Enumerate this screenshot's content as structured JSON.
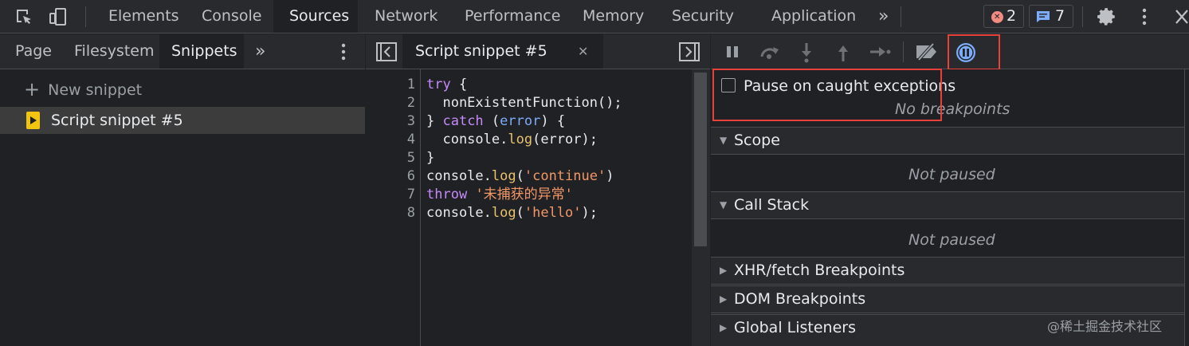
{
  "top_tabs": [
    "Elements",
    "Console",
    "Sources",
    "Network",
    "Performance",
    "Memory",
    "Security",
    "Application"
  ],
  "active_top_tab": "Sources",
  "more_tabs_glyph": "»",
  "badges": {
    "errors": "2",
    "messages": "7"
  },
  "navigator": {
    "tabs": [
      "Page",
      "Filesystem",
      "Snippets"
    ],
    "active_tab": "Snippets",
    "new_snippet": "New snippet",
    "snippets": [
      "Script snippet #5"
    ]
  },
  "editor": {
    "tab_label": "Script snippet #5",
    "line_numbers": [
      "1",
      "2",
      "3",
      "4",
      "5",
      "6",
      "7",
      "8"
    ],
    "lines": [
      [
        {
          "t": "try",
          "c": "kw"
        },
        {
          "t": " {",
          "c": "pr"
        }
      ],
      [
        {
          "t": "  nonExistentFunction();",
          "c": "fn"
        }
      ],
      [
        {
          "t": "} ",
          "c": "pr"
        },
        {
          "t": "catch",
          "c": "kw"
        },
        {
          "t": " (",
          "c": "pr"
        },
        {
          "t": "error",
          "c": "param"
        },
        {
          "t": ") {",
          "c": "pr"
        }
      ],
      [
        {
          "t": "  console.",
          "c": "pr"
        },
        {
          "t": "log",
          "c": "mth"
        },
        {
          "t": "(error);",
          "c": "pr"
        }
      ],
      [
        {
          "t": "}",
          "c": "pr"
        }
      ],
      [
        {
          "t": "console.",
          "c": "pr"
        },
        {
          "t": "log",
          "c": "mth"
        },
        {
          "t": "(",
          "c": "pr"
        },
        {
          "t": "'continue'",
          "c": "str"
        },
        {
          "t": ")",
          "c": "pr"
        }
      ],
      [
        {
          "t": "throw",
          "c": "kw"
        },
        {
          "t": " ",
          "c": "pr"
        },
        {
          "t": "'未捕获的异常'",
          "c": "str"
        }
      ],
      [
        {
          "t": "console.",
          "c": "pr"
        },
        {
          "t": "log",
          "c": "mth"
        },
        {
          "t": "(",
          "c": "pr"
        },
        {
          "t": "'hello'",
          "c": "str"
        },
        {
          "t": ");",
          "c": "pr"
        }
      ]
    ]
  },
  "debugger": {
    "pause_caught_label": "Pause on caught exceptions",
    "no_breakpoints": "No breakpoints",
    "scope_title": "Scope",
    "scope_status": "Not paused",
    "callstack_title": "Call Stack",
    "callstack_status": "Not paused",
    "xhr_title": "XHR/fetch Breakpoints",
    "dom_title": "DOM Breakpoints",
    "global_title": "Global Listeners"
  },
  "watermark": "@稀土掘金技术社区",
  "colors": {
    "accent": "#7cacf8",
    "highlight_box": "#e8403a",
    "error": "#f28b82"
  }
}
